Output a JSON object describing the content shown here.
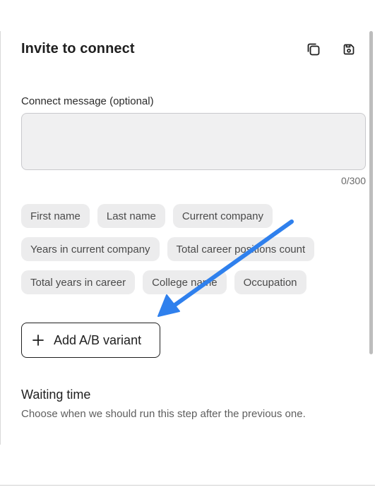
{
  "step": {
    "title": "Invite to connect",
    "copy_icon": "copy-icon",
    "save_icon": "save-icon"
  },
  "message": {
    "label": "Connect message (optional)",
    "value": "",
    "placeholder": "",
    "char_count": "0/300"
  },
  "variables": [
    "First name",
    "Last name",
    "Current company",
    "Years in current company",
    "Total career positions count",
    "Total years in career",
    "College name",
    "Occupation"
  ],
  "ab_variant": {
    "label": "Add A/B variant",
    "icon": "plus-icon"
  },
  "waiting": {
    "title": "Waiting time",
    "description": "Choose when we should run this step after the previous one."
  },
  "annotation": {
    "icon": "pointer-arrow-icon",
    "color": "#2f80ed"
  }
}
